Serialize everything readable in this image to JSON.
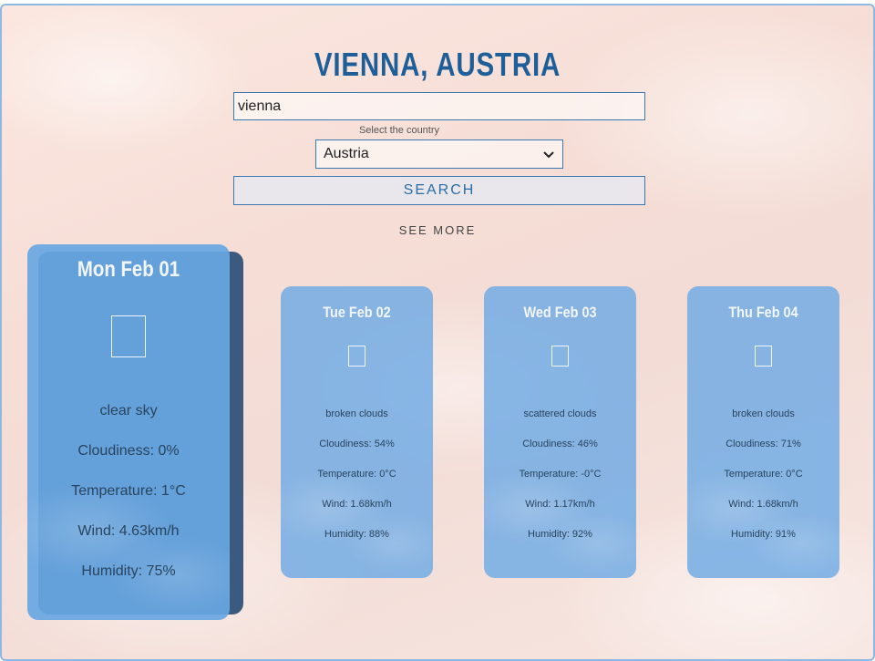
{
  "header": {
    "title": "VIENNA, AUSTRIA"
  },
  "search": {
    "value": "vienna",
    "country_label": "Select the country",
    "country_selected": "Austria",
    "button_label": "SEARCH"
  },
  "see_more_label": "SEE MORE",
  "colors": {
    "accent": "#1f5f99",
    "card": "#6eaae4",
    "card_shadow": "#3b5a7d"
  },
  "forecast": [
    {
      "date": "Mon Feb 01",
      "icon": "weather-icon",
      "description": "clear sky",
      "cloudiness": "Cloudiness: 0%",
      "temperature": "Temperature: 1°C",
      "wind": "Wind: 4.63km/h",
      "humidity": "Humidity: 75%"
    },
    {
      "date": "Tue Feb 02",
      "icon": "weather-icon",
      "description": "broken clouds",
      "cloudiness": "Cloudiness: 54%",
      "temperature": "Temperature: 0°C",
      "wind": "Wind: 1.68km/h",
      "humidity": "Humidity: 88%"
    },
    {
      "date": "Wed Feb 03",
      "icon": "weather-icon",
      "description": "scattered clouds",
      "cloudiness": "Cloudiness: 46%",
      "temperature": "Temperature: -0°C",
      "wind": "Wind: 1.17km/h",
      "humidity": "Humidity: 92%"
    },
    {
      "date": "Thu Feb 04",
      "icon": "weather-icon",
      "description": "broken clouds",
      "cloudiness": "Cloudiness: 71%",
      "temperature": "Temperature: 0°C",
      "wind": "Wind: 1.68km/h",
      "humidity": "Humidity: 91%"
    }
  ]
}
